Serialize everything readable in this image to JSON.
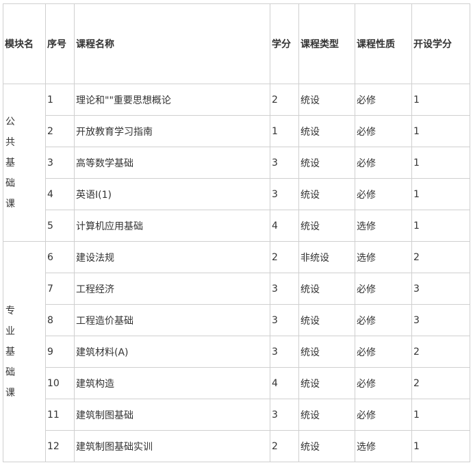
{
  "headers": [
    "模块名",
    "序号",
    "课程名称",
    "学分",
    "课程类型",
    "课程性质",
    "开设学分"
  ],
  "modules": [
    {
      "name_chars": [
        "公",
        "共",
        "基",
        "础",
        "课"
      ],
      "rows": [
        [
          "1",
          "理论和\"\"重要思想概论",
          "2",
          "统设",
          "必修",
          "1"
        ],
        [
          "2",
          "开放教育学习指南",
          "1",
          "统设",
          "必修",
          "1"
        ],
        [
          "3",
          "高等数学基础",
          "3",
          "统设",
          "必修",
          "1"
        ],
        [
          "4",
          "英语Ⅰ(1)",
          "3",
          "统设",
          "必修",
          "1"
        ],
        [
          "5",
          "计算机应用基础",
          "4",
          "统设",
          "选修",
          "1"
        ]
      ]
    },
    {
      "name_chars": [
        "专",
        "业",
        "基",
        "础",
        "课"
      ],
      "rows": [
        [
          "6",
          "建设法规",
          "2",
          "非统设",
          "选修",
          "2"
        ],
        [
          "7",
          "工程经济",
          "3",
          "统设",
          "必修",
          "3"
        ],
        [
          "8",
          "工程造价基础",
          "3",
          "统设",
          "必修",
          "3"
        ],
        [
          "9",
          "建筑材料(A)",
          "3",
          "统设",
          "必修",
          "2"
        ],
        [
          "10",
          "建筑构造",
          "4",
          "统设",
          "必修",
          "2"
        ],
        [
          "11",
          "建筑制图基础",
          "3",
          "统设",
          "必修",
          "1"
        ],
        [
          "12",
          "建筑制图基础实训",
          "2",
          "统设",
          "选修",
          "1"
        ]
      ]
    }
  ]
}
